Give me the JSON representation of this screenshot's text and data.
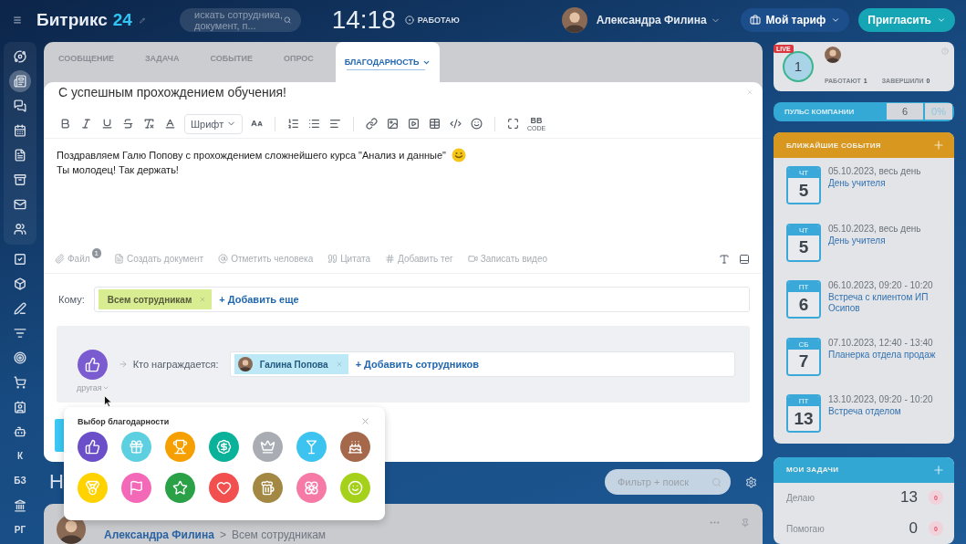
{
  "topbar": {
    "logo": "Битрикс",
    "logo_accent": "24",
    "search": {
      "placeholder": "искать сотрудника, документ, п..."
    },
    "clock": "14:18",
    "status": "РАБОТАЮ",
    "user": "Александра Филина",
    "tariff_button": "Мой тариф",
    "invite_button": "Пригласить"
  },
  "sidebar": {
    "pinned": [
      {
        "kind": "network",
        "selected": false
      },
      {
        "kind": "newspaper",
        "selected": true
      },
      {
        "kind": "chat",
        "selected": false
      },
      {
        "kind": "calendar",
        "selected": false
      },
      {
        "kind": "document",
        "selected": false
      },
      {
        "kind": "archive",
        "selected": false
      },
      {
        "kind": "mail",
        "selected": false
      },
      {
        "kind": "group",
        "selected": false
      }
    ],
    "items": [
      {
        "kind": "check",
        "selected": false
      },
      {
        "kind": "box",
        "selected": false
      },
      {
        "kind": "pen",
        "selected": false
      },
      {
        "kind": "filter",
        "selected": false
      },
      {
        "kind": "target",
        "selected": false
      },
      {
        "kind": "cart",
        "selected": false
      },
      {
        "kind": "contact",
        "selected": false
      },
      {
        "kind": "robot",
        "selected": false
      },
      {
        "kind": "text",
        "label": "К",
        "selected": false
      },
      {
        "kind": "text",
        "label": "БЗ",
        "selected": false
      },
      {
        "kind": "building",
        "selected": false
      },
      {
        "kind": "text",
        "label": "РГ",
        "selected": false
      }
    ]
  },
  "composer": {
    "tabs": [
      {
        "label": "СООБЩЕНИЕ",
        "selected": false,
        "dropdown": false
      },
      {
        "label": "ЗАДАЧА",
        "selected": false,
        "dropdown": false
      },
      {
        "label": "СОБЫТИЕ",
        "selected": false,
        "dropdown": false
      },
      {
        "label": "ОПРОС",
        "selected": false,
        "dropdown": false
      },
      {
        "label": "БЛАГОДАРНОСТЬ",
        "selected": true,
        "dropdown": true
      }
    ],
    "title": "С успешным прохождением обучения!",
    "toolbar": [
      {
        "kind": "bold"
      },
      {
        "kind": "italic"
      },
      {
        "kind": "underline"
      },
      {
        "kind": "strike"
      },
      {
        "kind": "clear"
      },
      {
        "kind": "color"
      },
      {
        "kind": "select",
        "label": "Шрифт"
      },
      {
        "kind": "size"
      },
      {
        "kind": "separator"
      },
      {
        "kind": "ordered"
      },
      {
        "kind": "bullets"
      },
      {
        "kind": "align"
      },
      {
        "kind": "separator"
      },
      {
        "kind": "link"
      },
      {
        "kind": "image"
      },
      {
        "kind": "video"
      },
      {
        "kind": "table"
      },
      {
        "kind": "code"
      },
      {
        "kind": "smile"
      },
      {
        "kind": "separator"
      },
      {
        "kind": "fullscreen"
      },
      {
        "kind": "bbcode",
        "label": "BB",
        "sub": "CODE"
      }
    ],
    "body": [
      "Поздравляем Галю Попову с прохождением сложнейшего курса \"Анализ и данные\"",
      "Ты молодец! Так держать!"
    ],
    "actions": [
      {
        "kind": "file",
        "label": "Файл",
        "badge": "1"
      },
      {
        "kind": "doc",
        "label": "Создать документ"
      },
      {
        "kind": "at",
        "label": "Отметить человека"
      },
      {
        "kind": "quote",
        "label": "Цитата"
      },
      {
        "kind": "hash",
        "label": "Добавить тег"
      },
      {
        "kind": "camera",
        "label": "Записать видео"
      }
    ],
    "to_label": "Кому:",
    "recipients": [
      {
        "label": "Всем сотрудникам"
      }
    ],
    "add_recipient": "+ Добавить еще",
    "gratitude": {
      "kind": "thumbs",
      "color": "#7b5cd0",
      "type_label": "другая",
      "awarded_label": "Кто награждается:",
      "people": [
        {
          "name": "Галина Попова"
        }
      ],
      "add_people": "+ Добавить сотрудников"
    }
  },
  "gratitude_picker": {
    "title": "Выбор благодарности",
    "options": [
      {
        "kind": "thumbs",
        "color": "#6a4fc9"
      },
      {
        "kind": "gift",
        "color": "#5ccfe0"
      },
      {
        "kind": "trophy",
        "color": "#f5a000"
      },
      {
        "kind": "money",
        "color": "#0ab29a"
      },
      {
        "kind": "crown",
        "color": "#a9adb3"
      },
      {
        "kind": "cocktail",
        "color": "#3dc3f0"
      },
      {
        "kind": "cake",
        "color": "#a5684a"
      },
      {
        "kind": "coin",
        "color": "#ffd200"
      },
      {
        "kind": "flag",
        "color": "#f369b7"
      },
      {
        "kind": "star",
        "color": "#2aa146"
      },
      {
        "kind": "heart",
        "color": "#f24f4f"
      },
      {
        "kind": "beer",
        "color": "#a38844"
      },
      {
        "kind": "flower",
        "color": "#f57ba6"
      },
      {
        "kind": "smile",
        "color": "#a5d11b"
      }
    ]
  },
  "feed": {
    "heading": "Н",
    "filter": {
      "placeholder": "Фильтр + поиск"
    },
    "post": {
      "author": "Александра Филина",
      "separator": ">",
      "audience": "Всем сотрудникам"
    }
  },
  "pulse": {
    "live": "LIVE",
    "count": "1",
    "stats": [
      {
        "label": "РАБОТАЮТ",
        "value": "1"
      },
      {
        "label": "ЗАВЕРШИЛИ",
        "value": "0"
      }
    ],
    "bar_label": "ПУЛЬС КОМПАНИИ",
    "bar_value": "6",
    "bar_percent": "0%"
  },
  "events": {
    "title": "БЛИЖАЙШИЕ СОБЫТИЯ",
    "items": [
      {
        "weekday": "ЧТ",
        "day": "5",
        "time": "05.10.2023, весь день",
        "title": "День учителя"
      },
      {
        "weekday": "ЧТ",
        "day": "5",
        "time": "05.10.2023, весь день",
        "title": "День учителя"
      },
      {
        "weekday": "ПТ",
        "day": "6",
        "time": "06.10.2023, 09:20 - 10:20",
        "title": "Встреча с клиентом ИП Осипов"
      },
      {
        "weekday": "СБ",
        "day": "7",
        "time": "07.10.2023, 12:40 - 13:40",
        "title": "Планерка отдела продаж"
      },
      {
        "weekday": "ПТ",
        "day": "13",
        "time": "13.10.2023, 09:20 - 10:20",
        "title": "Встреча отделом"
      }
    ]
  },
  "tasks": {
    "title": "МОИ ЗАДАЧИ",
    "rows": [
      {
        "label": "Делаю",
        "count": "13",
        "badge": "0"
      },
      {
        "label": "Помогаю",
        "count": "0",
        "badge": "0"
      }
    ]
  }
}
